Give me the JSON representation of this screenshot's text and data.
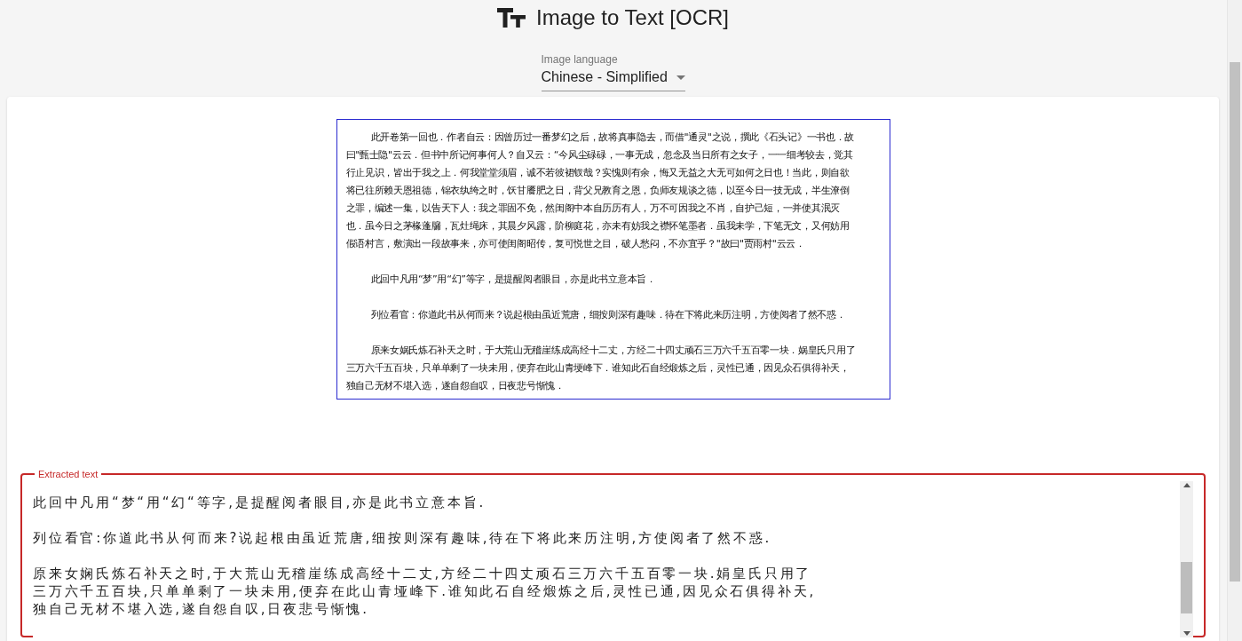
{
  "header": {
    "title": "Image to Text [OCR]"
  },
  "language_select": {
    "label": "Image language",
    "value": "Chinese - Simplified"
  },
  "source_image": {
    "paragraphs": [
      {
        "lines": [
          "此开卷第一回也．作者自云：因曾历过一番梦幻之后，故将真事隐去，而借\"通灵\"之说，撰此《石头记》一书也．故",
          "曰\"甄士隐\"云云．但书中所记何事何人？自又云：“今风尘碌碌，一事无成，忽念及当日所有之女子，一一细考较去，觉其",
          "行止见识，皆出于我之上．何我堂堂须眉，诚不若彼裙钗哉？实愧则有余，悔又无益之大无可如何之日也！当此，则自欲",
          "将已往所赖天恩祖德，锦衣纨绔之时，饫甘餍肥之日，背父兄教育之恩，负师友规谈之德，以至今日一技无成，半生潦倒",
          "之罪，编述一集，以告天下人：我之罪固不免，然闺阁中本自历历有人，万不可因我之不肖，自护己短，一并使其泯灭",
          "也．虽今日之茅椽蓬牖，瓦灶绳床，其晨夕风露，阶柳庭花，亦未有妨我之襟怀笔墨者．虽我未学，下笔无文，又何妨用",
          "假语村言，敷演出一段故事来，亦可使闺阁昭传，复可悦世之目，破人愁闷，不亦宜乎？\"故曰\"贾雨村\"云云．"
        ]
      },
      {
        "lines": [
          "此回中凡用“梦”用“幻”等字，是提醒阅者眼目，亦是此书立意本旨．"
        ]
      },
      {
        "lines": [
          "列位看官：你道此书从何而来？说起根由虽近荒唐，细按则深有趣味．待在下将此来历注明，方使阅者了然不惑．"
        ]
      },
      {
        "lines": [
          "原来女娲氏炼石补天之时，于大荒山无稽崖练成高经十二丈，方经二十四丈顽石三万六千五百零一块．娲皇氏只用了",
          "三万六千五百块，只单单剩了一块未用，便弃在此山青埂峰下．谁知此石自经煅炼之后，灵性已通，因见众石俱得补天，",
          "独自己无材不堪入选，遂自怨自叹，日夜悲号惭愧．"
        ]
      }
    ]
  },
  "extracted_text": {
    "label": "Extracted text",
    "paragraphs": [
      {
        "lines": [
          "此回中凡用“梦“用“幻“等字,是提醒阅者眼目,亦是此书立意本旨."
        ]
      },
      {
        "lines": [
          "列位看官:你道此书从何而来?说起根由虽近荒唐,细按则深有趣味,待在下将此来历注明,方使阅者了然不惑."
        ]
      },
      {
        "lines": [
          "原来女娴氏炼石补天之时,于大荒山无稽崖练成高经十二丈,方经二十四丈顽石三万六千五百零一块.娟皇氏只用了",
          "三万六千五百块,只单单剩了一块未用,便弃在此山青垭峰下.谁知此石自经煅炼之后,灵性已通,因见众石俱得补天,",
          "独自己无材不堪入选,遂自怨自叹,日夜悲号惭愧."
        ]
      }
    ]
  }
}
